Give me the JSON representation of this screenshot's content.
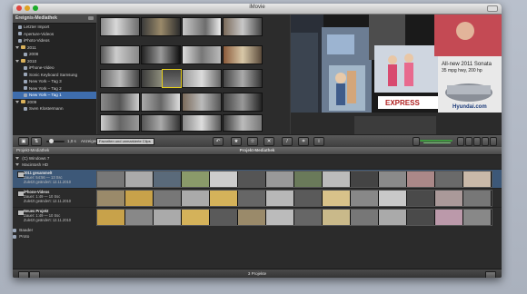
{
  "window": {
    "title": "iMovie"
  },
  "event_library": {
    "header": "Ereignis-Mediathek",
    "items": [
      {
        "label": "Letzter Import",
        "indent": 1,
        "icon": "star-icon",
        "selected": false
      },
      {
        "label": "Aperture-Videos",
        "indent": 1,
        "icon": "star-icon",
        "selected": false
      },
      {
        "label": "iPhoto-Videos",
        "indent": 1,
        "icon": "star-icon",
        "selected": false
      },
      {
        "label": "2011",
        "indent": 0,
        "icon": "folder-icon",
        "selected": false
      },
      {
        "label": "2008",
        "indent": 2,
        "icon": "star-icon",
        "selected": false
      },
      {
        "label": "2010",
        "indent": 0,
        "icon": "folder-icon",
        "selected": false
      },
      {
        "label": "iPhone-Video",
        "indent": 2,
        "icon": "star-icon",
        "selected": false
      },
      {
        "label": "Sonic Keyboard Samsung",
        "indent": 2,
        "icon": "star-icon",
        "selected": false
      },
      {
        "label": "New York – Tag 3",
        "indent": 2,
        "icon": "star-icon",
        "selected": false
      },
      {
        "label": "New York – Tag 2",
        "indent": 2,
        "icon": "star-icon",
        "selected": false
      },
      {
        "label": "New York – Tag 1",
        "indent": 2,
        "icon": "star-icon",
        "selected": true
      },
      {
        "label": "2009",
        "indent": 0,
        "icon": "folder-icon",
        "selected": false
      },
      {
        "label": "Sven Klostermann",
        "indent": 2,
        "icon": "star-icon",
        "selected": false
      }
    ]
  },
  "toolbar": {
    "show_label": "Anzeigen:",
    "show_value": "Favoriten und unmarkierte Clips",
    "all_label": "Alle",
    "duration_label": "1,0 s",
    "buttons": [
      "undo-icon",
      "star-icon",
      "unstar-icon",
      "reject-icon",
      "tool-icon",
      "crop-icon",
      "info-icon"
    ]
  },
  "project_library": {
    "left_header": "Projekt-Mediathek",
    "center_header": "Projekt-Mediathek",
    "drives": [
      {
        "label": "(C) Windows 7"
      },
      {
        "label": "Macintosh HD"
      }
    ],
    "projects": [
      {
        "name": "2011 gesammelt",
        "duration": "Dauer: 54:56 — 13 Ssc",
        "created": "Zuletzt geändert: 12.11.2010",
        "selected": true
      },
      {
        "name": "iPhone-Videos",
        "duration": "Dauer: 1:49 — 10 Ssc",
        "created": "Zuletzt geändert: 12.11.2010",
        "selected": false
      },
      {
        "name": "Neues Projekt",
        "duration": "Dauer: 1:49 — 10 Ssc",
        "created": "Zuletzt geändert: 12.11.2010",
        "selected": false
      }
    ],
    "extra_items": [
      {
        "label": "Baader"
      },
      {
        "label": "Proto"
      }
    ],
    "footer": "3 Projekte"
  },
  "colors": {
    "accent": "#3e6dad",
    "selection_yellow": "#e8d11a"
  }
}
